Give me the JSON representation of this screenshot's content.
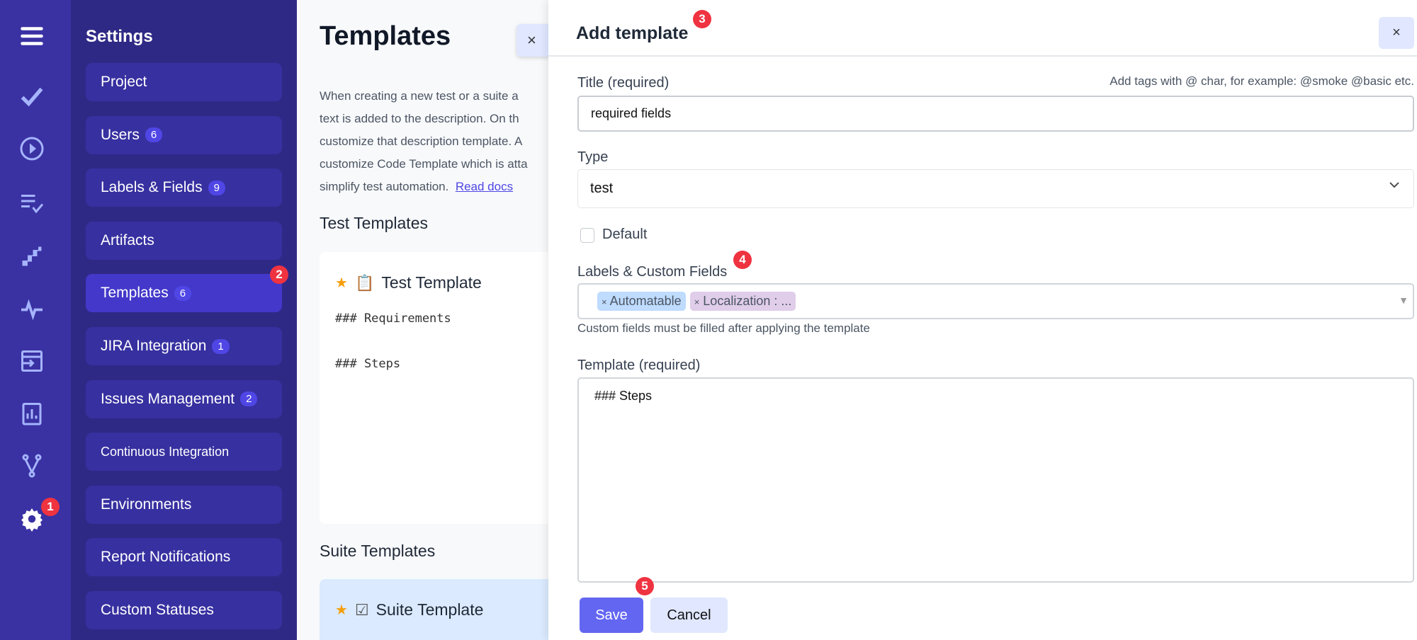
{
  "rail": {
    "icons": [
      "menu-icon",
      "check-icon",
      "play-circle-icon",
      "checklist-icon",
      "steps-icon",
      "pulse-icon",
      "import-icon",
      "analytics-icon",
      "branch-icon",
      "gear-icon"
    ]
  },
  "settings": {
    "title": "Settings",
    "items": [
      {
        "label": "Project",
        "count": null
      },
      {
        "label": "Users",
        "count": "6"
      },
      {
        "label": "Labels & Fields",
        "count": "9"
      },
      {
        "label": "Artifacts",
        "count": null
      },
      {
        "label": "Templates",
        "count": "6",
        "active": true
      },
      {
        "label": "JIRA Integration",
        "count": "1"
      },
      {
        "label": "Issues Management",
        "count": "2"
      },
      {
        "label": "Continuous Integration",
        "count": null
      },
      {
        "label": "Environments",
        "count": null
      },
      {
        "label": "Report Notifications",
        "count": null
      },
      {
        "label": "Custom Statuses",
        "count": null
      }
    ]
  },
  "markers": [
    "1",
    "2",
    "3",
    "4",
    "5"
  ],
  "main": {
    "title": "Templates",
    "close": "×",
    "description": [
      "When creating a new test or a suite a",
      "text is added to the description. On th",
      "customize that description template. A",
      "customize Code Template which is atta",
      "simplify test automation."
    ],
    "read_docs": "Read docs",
    "test_section": "Test Templates",
    "test_card": {
      "title": "Test Template",
      "lines": [
        "### Requirements",
        "### Steps"
      ]
    },
    "suite_section": "Suite Templates",
    "suite_card": {
      "title": "Suite Template"
    }
  },
  "drawer": {
    "title": "Add template",
    "close": "×",
    "title_label": "Title (required)",
    "tags_hint": "Add tags with @ char, for example: @smoke @basic etc.",
    "title_value": "required fields",
    "type_label": "Type",
    "type_value": "test",
    "default_label": "Default",
    "default_checked": false,
    "labels_label": "Labels & Custom Fields",
    "chips": [
      {
        "label": "Automatable",
        "color": "#bfdbfe"
      },
      {
        "label": "Localization : ...",
        "color": "#e0cdea"
      }
    ],
    "chip_remove": "×",
    "help": "Custom fields must be filled after applying the template",
    "template_label": "Template (required)",
    "template_value": "### Steps",
    "save": "Save",
    "cancel": "Cancel"
  },
  "colors": {
    "rail": "#3a31a3",
    "nav": "#2f2986",
    "accent": "#6366f1",
    "marker": "#ef3340"
  }
}
